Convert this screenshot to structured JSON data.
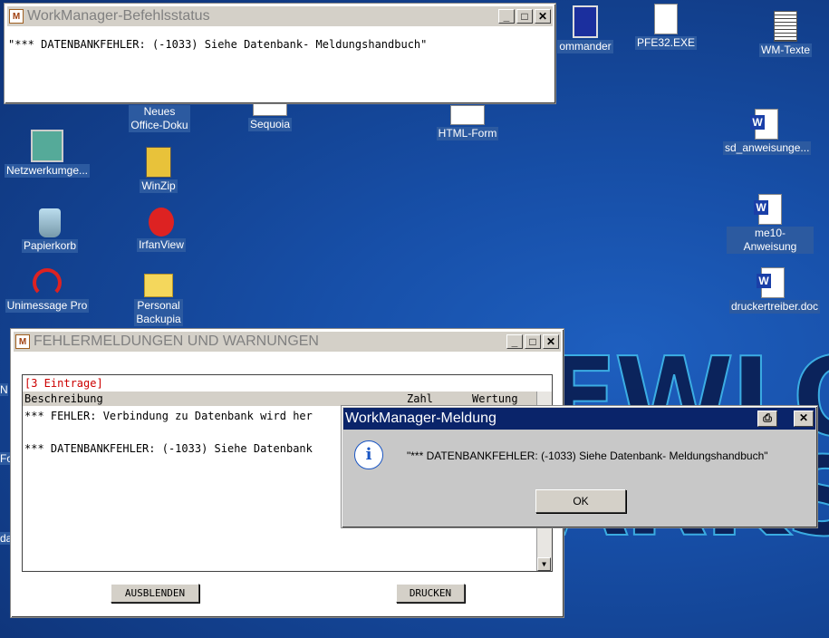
{
  "desktop": {
    "background_text": "EWLO\nARKS",
    "icons": [
      {
        "label": "Netzwerkumge...",
        "icon": "network-icon"
      },
      {
        "label": "Papierkorb",
        "icon": "recycle-bin-icon"
      },
      {
        "label": "Unimessage Pro",
        "icon": "headset-icon"
      },
      {
        "label": "Neues\nOffice-Doku",
        "icon": "office-doc-icon"
      },
      {
        "label": "WinZip",
        "icon": "winzip-icon"
      },
      {
        "label": "IrfanView",
        "icon": "irfanview-icon"
      },
      {
        "label": "Personal\nBackupia",
        "icon": "folder-icon"
      },
      {
        "label": "Sequoia",
        "icon": "shortcut-icon"
      },
      {
        "label": "HTML-Form",
        "icon": "shortcut-icon"
      },
      {
        "label": "ommander",
        "icon": "floppy-icon"
      },
      {
        "label": "PFE32.EXE",
        "icon": "pfe-icon"
      },
      {
        "label": "WM-Texte",
        "icon": "text-file-icon"
      },
      {
        "label": "sd_anweisunge...",
        "icon": "word-doc-icon"
      },
      {
        "label": "me10-Anweisung",
        "icon": "word-doc-icon"
      },
      {
        "label": "druckertreiber.doc",
        "icon": "word-doc-icon"
      },
      {
        "label": "N",
        "icon": ""
      },
      {
        "label": "Fo",
        "icon": ""
      },
      {
        "label": "da",
        "icon": ""
      }
    ]
  },
  "status_window": {
    "title": "WorkManager-Befehlsstatus",
    "message": "\"*** DATENBANKFEHLER: (-1033) Siehe Datenbank- Meldungshandbuch\""
  },
  "errors_window": {
    "title": "FEHLERMELDUNGEN UND WARNUNGEN",
    "count_label": "[3 Eintrage]",
    "columns": [
      "Beschreibung",
      "Zahl",
      "Wertung"
    ],
    "rows": [
      "*** FEHLER: Verbindung zu Datenbank wird her",
      "",
      "*** DATENBANKFEHLER: (-1033) Siehe Datenbank"
    ],
    "hide_button": "AUSBLENDEN",
    "print_button": "DRUCKEN",
    "colors": {
      "count_label": "#cc0000"
    }
  },
  "message_dialog": {
    "title": "WorkManager-Meldung",
    "message": "\"*** DATENBANKFEHLER: (-1033) Siehe Datenbank- Meldungshandbuch\"",
    "ok_button": "OK",
    "colors": {
      "titlebar": "#0a246a"
    }
  }
}
